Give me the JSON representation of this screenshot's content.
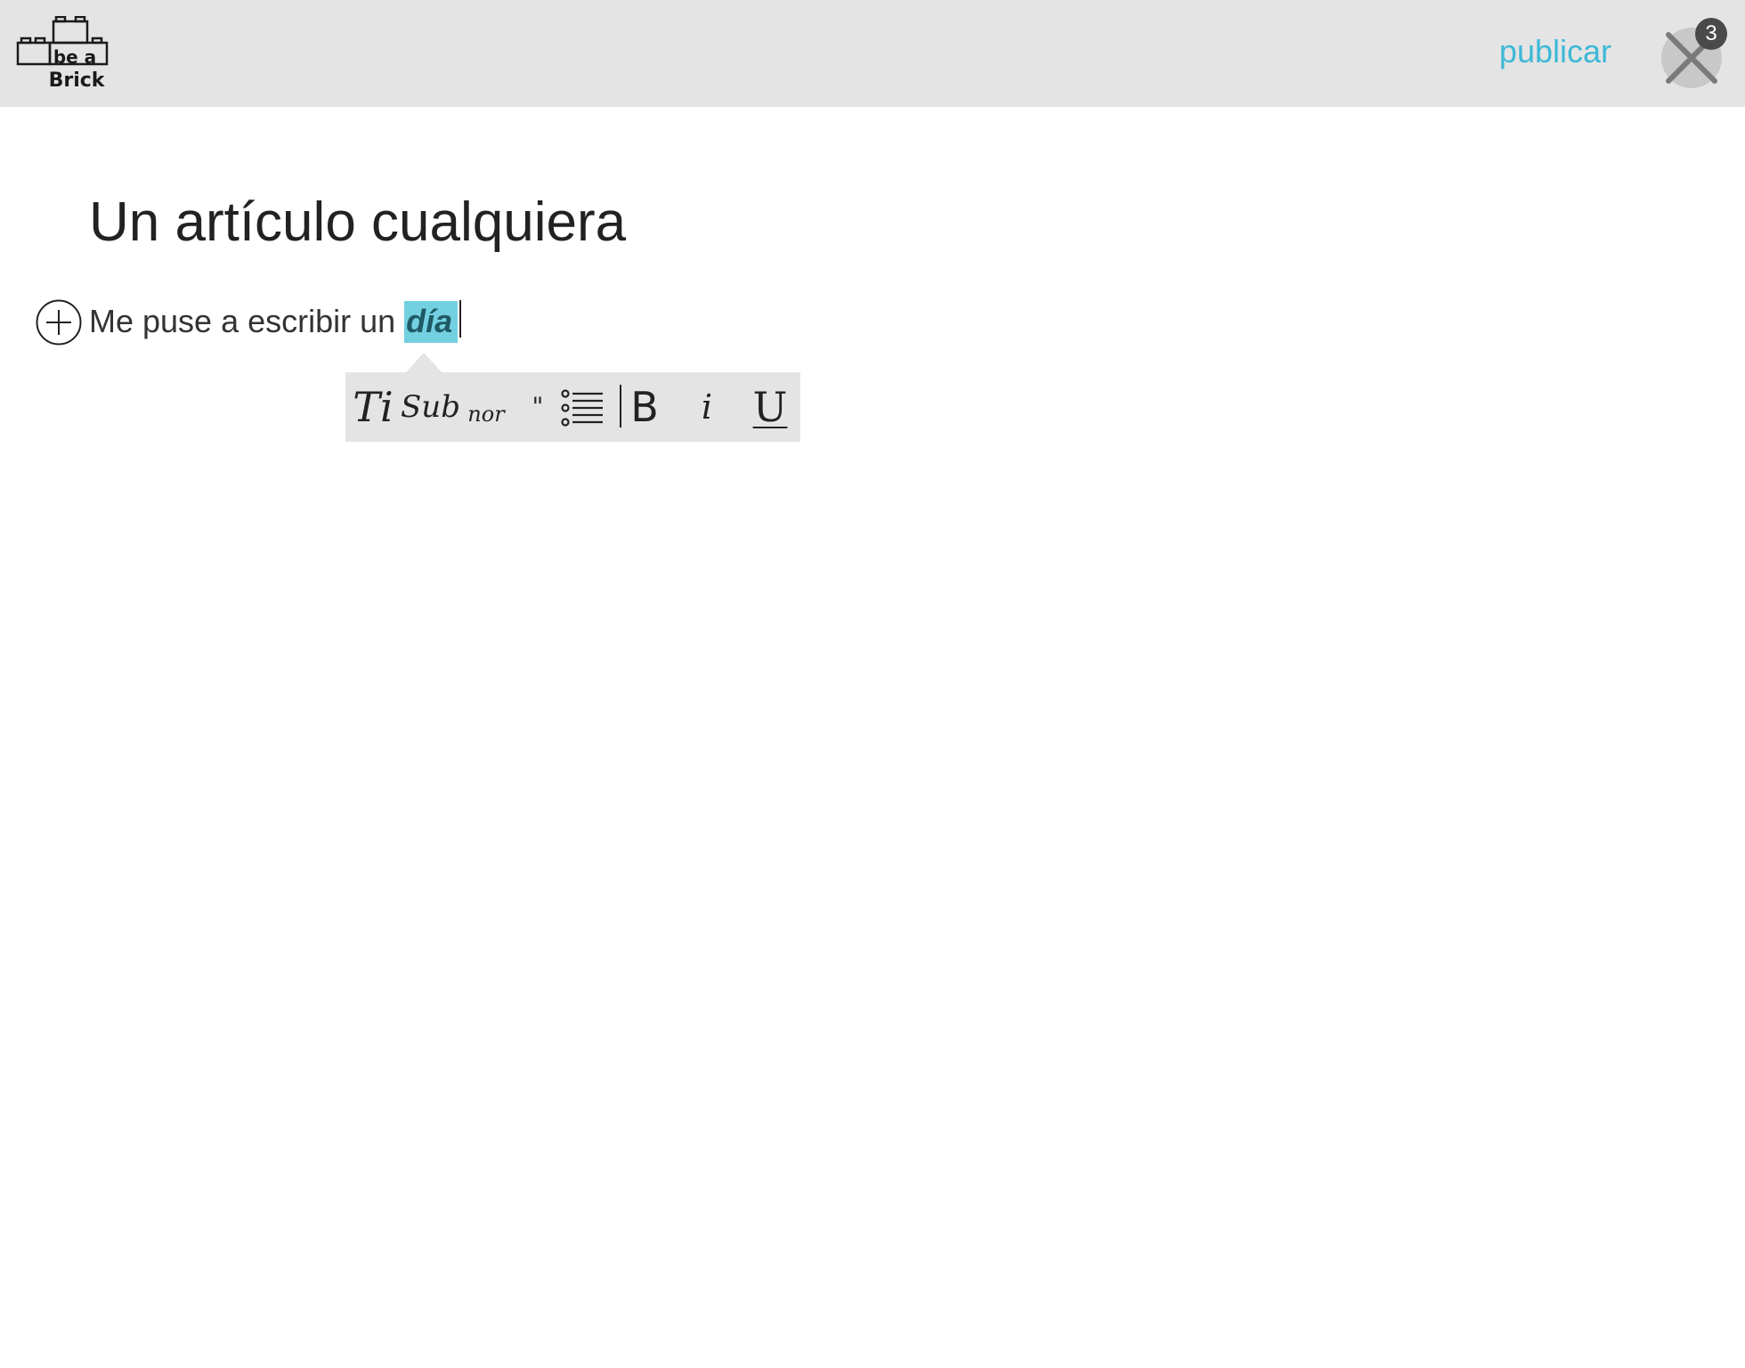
{
  "header": {
    "logo_text_top": "be a",
    "logo_text_bottom": "Brick",
    "publish_label": "publicar",
    "notification_count": "3"
  },
  "editor": {
    "title": "Un artículo cualquiera",
    "paragraph_text": "Me puse a escribir un ",
    "selected_text": "día"
  },
  "format_toolbar": {
    "title_label": "Ti",
    "subtitle_label": "Sub",
    "normal_label": "nor",
    "quote_label": "\"",
    "bold_label": "B",
    "italic_label": "i",
    "underline_label": "U"
  },
  "colors": {
    "accent": "#3db8d6",
    "selection": "#72d0e0",
    "topbar": "#e4e4e4"
  }
}
